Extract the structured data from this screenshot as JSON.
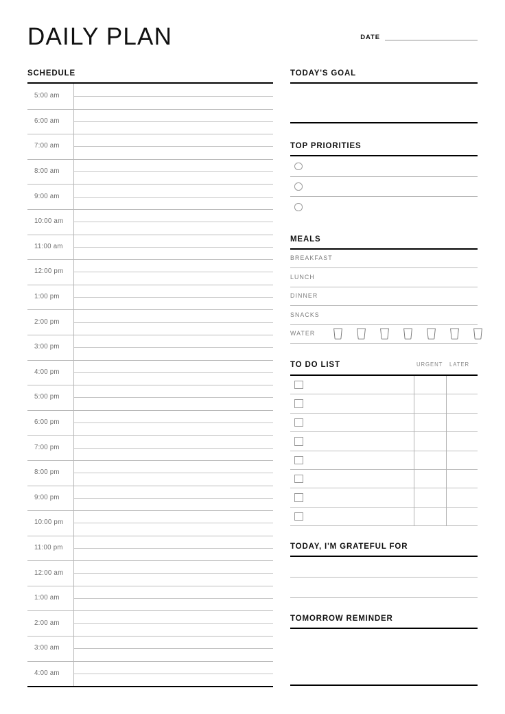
{
  "header": {
    "title": "DAILY PLAN",
    "date_label": "DATE",
    "date_value": ""
  },
  "schedule": {
    "heading": "SCHEDULE",
    "times": [
      "5:00 am",
      "6:00 am",
      "7:00 am",
      "8:00 am",
      "9:00 am",
      "10:00 am",
      "11:00 am",
      "12:00 pm",
      "1:00 pm",
      "2:00 pm",
      "3:00 pm",
      "4:00 pm",
      "5:00 pm",
      "6:00 pm",
      "7:00 pm",
      "8:00 pm",
      "9:00 pm",
      "10:00 pm",
      "11:00 pm",
      "12:00 am",
      "1:00 am",
      "2:00 am",
      "3:00 am",
      "4:00 am"
    ]
  },
  "goal": {
    "heading": "TODAY'S GOAL",
    "value": ""
  },
  "priorities": {
    "heading": "TOP PRIORITIES",
    "items": [
      {
        "value": "",
        "checked": false
      },
      {
        "value": "",
        "checked": false
      },
      {
        "value": "",
        "checked": false
      }
    ]
  },
  "meals": {
    "heading": "MEALS",
    "rows": [
      {
        "label": "BREAKFAST",
        "value": ""
      },
      {
        "label": "LUNCH",
        "value": ""
      },
      {
        "label": "DINNER",
        "value": ""
      },
      {
        "label": "SNACKS",
        "value": ""
      }
    ],
    "water": {
      "label": "WATER",
      "glass_count": 7,
      "glasses_filled": 0
    }
  },
  "todo": {
    "heading": "TO DO LIST",
    "col_urgent": "URGENT",
    "col_later": "LATER",
    "rows": [
      {
        "task": "",
        "checked": false,
        "urgent": "",
        "later": ""
      },
      {
        "task": "",
        "checked": false,
        "urgent": "",
        "later": ""
      },
      {
        "task": "",
        "checked": false,
        "urgent": "",
        "later": ""
      },
      {
        "task": "",
        "checked": false,
        "urgent": "",
        "later": ""
      },
      {
        "task": "",
        "checked": false,
        "urgent": "",
        "later": ""
      },
      {
        "task": "",
        "checked": false,
        "urgent": "",
        "later": ""
      },
      {
        "task": "",
        "checked": false,
        "urgent": "",
        "later": ""
      },
      {
        "task": "",
        "checked": false,
        "urgent": "",
        "later": ""
      }
    ]
  },
  "grateful": {
    "heading": "TODAY, I'M GRATEFUL FOR",
    "lines": [
      "",
      ""
    ]
  },
  "tomorrow": {
    "heading": "TOMORROW REMINDER",
    "value": ""
  },
  "colors": {
    "ink": "#111111",
    "rule_strong": "#000000",
    "rule_light": "#b9b9b9",
    "muted_text": "#7c7c7c",
    "paper": "#ffffff"
  }
}
